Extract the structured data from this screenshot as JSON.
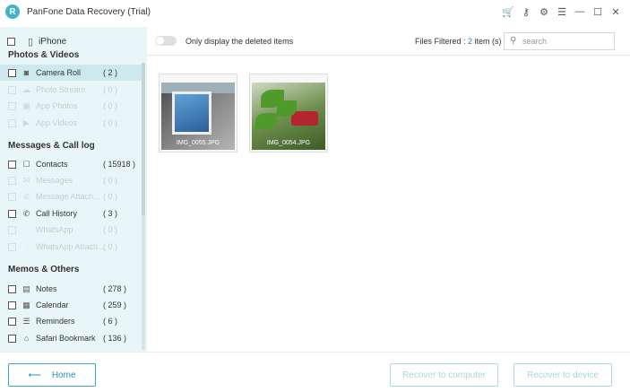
{
  "window": {
    "title": "PanFone Data Recovery (Trial)",
    "logo_letter": "R"
  },
  "titlebar_icons": [
    "cart-icon",
    "key-icon",
    "gear-icon",
    "menu-icon",
    "minimize-icon",
    "maximize-icon",
    "close-icon"
  ],
  "sidebar": {
    "device": "iPhone",
    "sections": [
      {
        "title": "Photos & Videos",
        "items": [
          {
            "label": "Camera Roll",
            "count": "( 2 )",
            "enabled": true,
            "selected": true,
            "icon": "camera-icon"
          },
          {
            "label": "Photo Stream",
            "count": "( 0 )",
            "enabled": false,
            "icon": "photo-stream-icon"
          },
          {
            "label": "App Photos",
            "count": "( 0 )",
            "enabled": false,
            "icon": "app-photos-icon"
          },
          {
            "label": "App Videos",
            "count": "( 0 )",
            "enabled": false,
            "icon": "app-videos-icon"
          }
        ]
      },
      {
        "title": "Messages & Call log",
        "items": [
          {
            "label": "Contacts",
            "count": "( 15918 )",
            "enabled": true,
            "icon": "contacts-icon"
          },
          {
            "label": "Messages",
            "count": "( 0 )",
            "enabled": false,
            "icon": "messages-icon"
          },
          {
            "label": "Message Attach...",
            "count": "( 0 )",
            "enabled": false,
            "icon": "attachment-icon"
          },
          {
            "label": "Call History",
            "count": "( 3 )",
            "enabled": true,
            "icon": "phone-icon"
          },
          {
            "label": "WhatsApp",
            "count": "( 0 )",
            "enabled": false,
            "icon": "whatsapp-icon"
          },
          {
            "label": "WhatsApp Attach...",
            "count": "( 0 )",
            "enabled": false,
            "icon": "whatsapp-attachment-icon"
          }
        ]
      },
      {
        "title": "Memos & Others",
        "items": [
          {
            "label": "Notes",
            "count": "( 278 )",
            "enabled": true,
            "icon": "notes-icon"
          },
          {
            "label": "Calendar",
            "count": "( 259 )",
            "enabled": true,
            "icon": "calendar-icon"
          },
          {
            "label": "Reminders",
            "count": "( 6 )",
            "enabled": true,
            "icon": "reminders-icon"
          },
          {
            "label": "Safari Bookmark",
            "count": "( 136 )",
            "enabled": true,
            "icon": "bookmark-icon"
          }
        ]
      }
    ]
  },
  "toolbar": {
    "toggle_label": "Only display the deleted items",
    "toggle_on": false,
    "filtered_prefix": "Files Filtered : ",
    "filtered_count": "2",
    "filtered_suffix": " item (s)",
    "search_placeholder": "search",
    "search_value": ""
  },
  "files": [
    {
      "name": "IMG_0055.JPG"
    },
    {
      "name": "IMG_0054.JPG"
    }
  ],
  "bottom": {
    "home_label": "Home",
    "recover_computer_label": "Recover to computer",
    "recover_device_label": "Recover to device"
  },
  "colors": {
    "accent": "#3fb5c8",
    "sidebar_bg": "#e9f6f8",
    "selected_bg": "#cde9ee",
    "count_highlight": "#2b7fb8",
    "cart": "#e8a323"
  }
}
